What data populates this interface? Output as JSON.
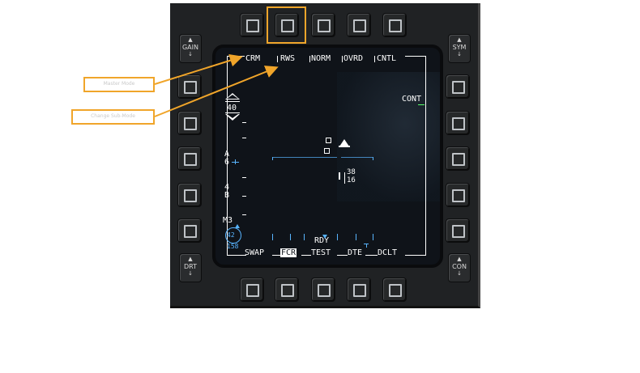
{
  "callouts": {
    "first": "Master Mode",
    "second": "Change Sub-Mode"
  },
  "mfd": {
    "top_labels": [
      "CRM",
      "RWS",
      "NORM",
      "OVRD",
      "CNTL"
    ],
    "bottom_labels": [
      "SWAP",
      "FCR",
      "TEST",
      "DTE",
      "DCLT"
    ],
    "right_label": "CONT",
    "left_rockers": [
      {
        "top": "▲",
        "label": "GAIN",
        "bottom": "↓"
      },
      {
        "top": "▲",
        "label": "DRT",
        "bottom": "↓"
      }
    ],
    "right_rockers": [
      {
        "top": "▲",
        "label": "SYM",
        "bottom": "↓"
      },
      {
        "top": "▲",
        "label": "CON",
        "bottom": "↓"
      }
    ],
    "range_value": "40",
    "azimuth_top": "A",
    "azimuth_bottom": "6",
    "bar_top": "4",
    "bar_bottom": "B",
    "scan_label": "M3",
    "circle_value": "42",
    "bottom_left_value": "158",
    "cursor_top": "38",
    "cursor_bottom": "16",
    "status": "RDY"
  },
  "colors": {
    "accent": "#f0a52a",
    "symbology": "#ffffff",
    "blue": "#58b4ff",
    "green": "#58ff6a"
  }
}
